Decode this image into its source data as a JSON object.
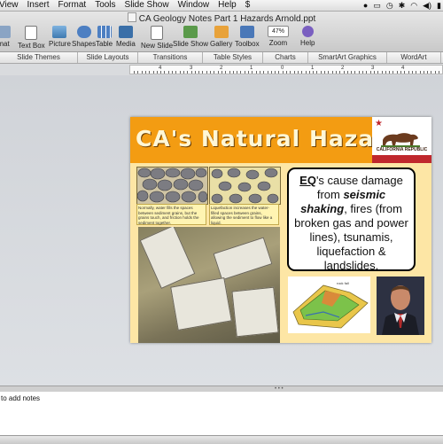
{
  "menubar": {
    "items": [
      "View",
      "Insert",
      "Format",
      "Tools",
      "Slide Show",
      "Window",
      "Help"
    ],
    "script_icon": "$"
  },
  "window": {
    "title": "CA Geology Notes Part 1 Hazards Arnold.ppt"
  },
  "toolbar": {
    "format_label": "mat",
    "text_box": "Text Box",
    "picture": "Picture",
    "shapes": "Shapes",
    "table": "Table",
    "media": "Media",
    "new_slide": "New Slide",
    "slide_show": "Slide Show",
    "gallery": "Gallery",
    "toolbox": "Toolbox",
    "zoom_value": "47%",
    "zoom_label": "Zoom",
    "help": "Help"
  },
  "ribbon": {
    "tabs": [
      "Slide Themes",
      "Slide Layouts",
      "Transitions",
      "Table Styles",
      "Charts",
      "SmartArt Graphics",
      "WordArt"
    ]
  },
  "ruler": {
    "labels": [
      "4",
      "3",
      "2",
      "1",
      "0",
      "1",
      "2",
      "3",
      "4"
    ]
  },
  "slide": {
    "title": "CA's Natural Hazards",
    "flag_text": "CALIFORNIA REPUBLIC",
    "caption_left": "Normally, water fills the spaces between sediment grains, but the grains touch, and friction holds the sediment together.",
    "caption_right": "Liquefaction increases the water-filled spaces between grains, allowing the sediment to flow like a liquid.",
    "diagram_label": "rock fall",
    "text": {
      "eq": "EQ",
      "line1_rest": "'s cause damage from ",
      "seismic": "seismic shaking",
      "line_rest": ", fires (from broken gas and power lines), tsunamis, liquefaction & landslides."
    }
  },
  "notes": {
    "placeholder": "to add notes"
  },
  "colors": {
    "title_bar": "#f39c12",
    "slide_bg": "#fde6a5",
    "flag_red": "#c0282d"
  }
}
